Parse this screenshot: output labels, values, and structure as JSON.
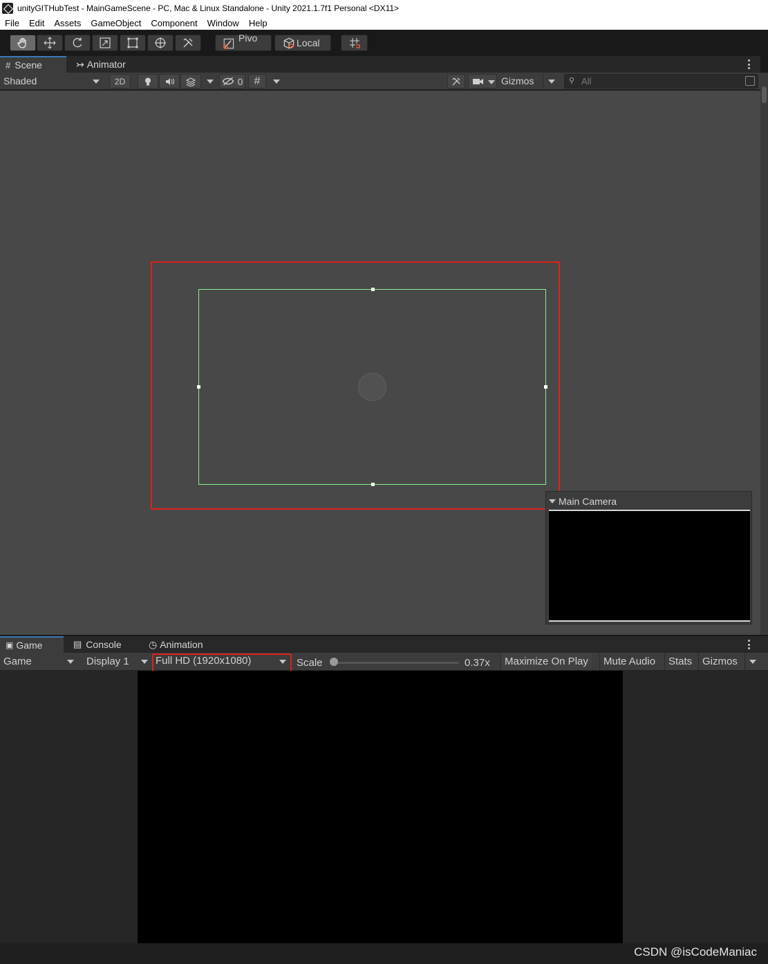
{
  "window": {
    "title": "unityGITHubTest - MainGameScene - PC, Mac & Linux Standalone - Unity 2021.1.7f1 Personal <DX11>"
  },
  "menu": [
    "File",
    "Edit",
    "Assets",
    "GameObject",
    "Component",
    "Window",
    "Help"
  ],
  "toolbar": {
    "tools": [
      "hand-tool",
      "move-tool",
      "rotate-tool",
      "scale-tool",
      "rect-tool",
      "transform-tool",
      "custom-tool"
    ],
    "pivot_label": "Pivo",
    "local_label": "Local"
  },
  "scene": {
    "tabs": [
      "Scene",
      "Animator"
    ],
    "shading_mode": "Shaded",
    "mode_2d": "2D",
    "hidden_count": "0",
    "gizmos_label": "Gizmos",
    "search_placeholder": "All",
    "camera_preview_title": "Main Camera"
  },
  "game": {
    "tabs": [
      "Game",
      "Console",
      "Animation"
    ],
    "view_mode": "Game",
    "display": "Display 1",
    "resolution": "Full HD (1920x1080)",
    "scale_label": "Scale",
    "scale_value": "0.37x",
    "scale_fraction": 0.0,
    "maximize_label": "Maximize On Play",
    "mute_label": "Mute Audio",
    "stats_label": "Stats",
    "gizmos_label": "Gizmos"
  },
  "watermark": "CSDN @isCodeManiac",
  "colors": {
    "highlight": "#e0201c",
    "camera_frame": "#8cf08c",
    "tab_accent": "#3a79bb"
  }
}
